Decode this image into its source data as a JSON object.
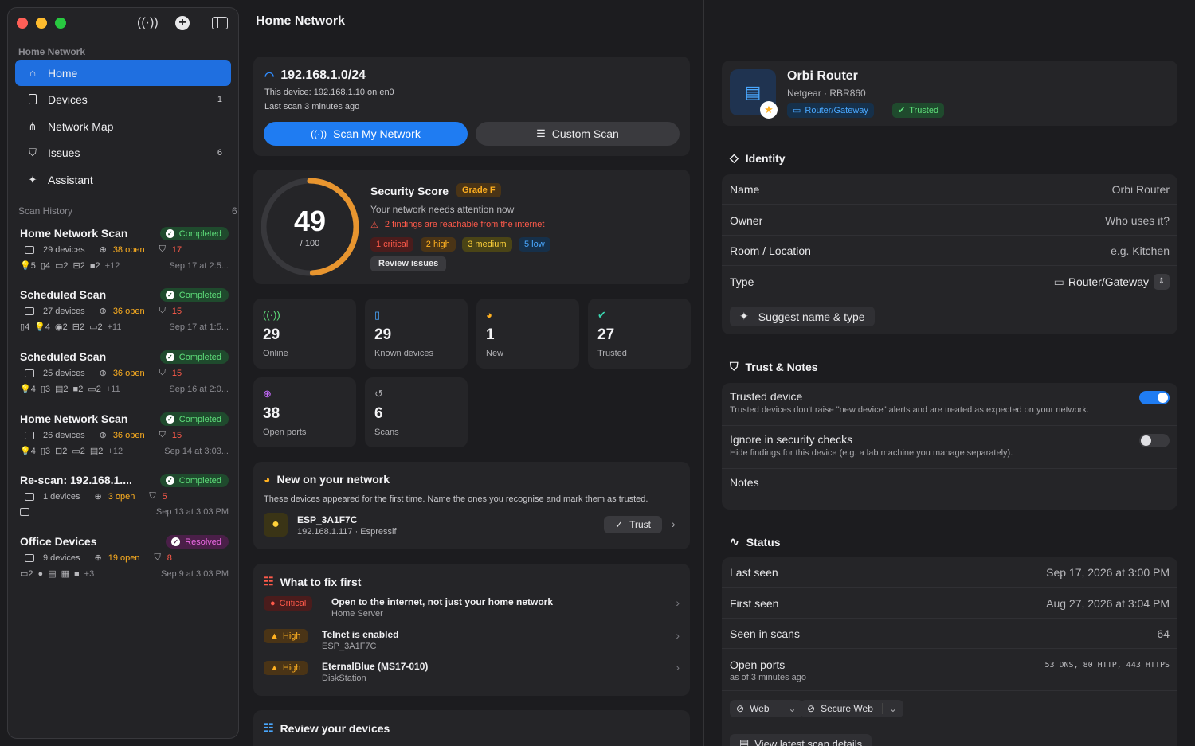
{
  "sidebar": {
    "section_title": "Home Network",
    "nav": [
      {
        "label": "Home",
        "count": ""
      },
      {
        "label": "Devices",
        "count": "1"
      },
      {
        "label": "Network Map",
        "count": ""
      },
      {
        "label": "Issues",
        "count": "6"
      },
      {
        "label": "Assistant",
        "count": ""
      }
    ],
    "history_title": "Scan History",
    "history_count": "6",
    "scans": [
      {
        "title": "Home Network Scan",
        "status": "Completed",
        "devices": "29 devices",
        "open": "38 open",
        "issues": "17",
        "icons": [
          "5",
          "4",
          "2",
          "2",
          "2",
          "+12"
        ],
        "date": "Sep 17 at 2:5..."
      },
      {
        "title": "Scheduled Scan",
        "status": "Completed",
        "devices": "27 devices",
        "open": "36 open",
        "issues": "15",
        "icons": [
          "4",
          "4",
          "2",
          "2",
          "2",
          "+11"
        ],
        "date": "Sep 17 at 1:5..."
      },
      {
        "title": "Scheduled Scan",
        "status": "Completed",
        "devices": "25 devices",
        "open": "36 open",
        "issues": "15",
        "icons": [
          "4",
          "3",
          "2",
          "2",
          "2",
          "+11"
        ],
        "date": "Sep 16 at 2:0..."
      },
      {
        "title": "Home Network Scan",
        "status": "Completed",
        "devices": "26 devices",
        "open": "36 open",
        "issues": "15",
        "icons": [
          "4",
          "3",
          "2",
          "2",
          "2",
          "+12"
        ],
        "date": "Sep 14 at 3:03..."
      },
      {
        "title": "Re-scan: 192.168.1....",
        "status": "Completed",
        "devices": "1 devices",
        "open": "3 open",
        "issues": "5",
        "icons": [],
        "date": "Sep 13 at 3:03 PM"
      },
      {
        "title": "Office Devices",
        "status": "Resolved",
        "devices": "9 devices",
        "open": "19 open",
        "issues": "8",
        "icons": [
          "2",
          "",
          "",
          "",
          "",
          "+3"
        ],
        "date": "Sep 9 at 3:03 PM"
      }
    ]
  },
  "main": {
    "title": "Home Network",
    "network": {
      "cidr": "192.168.1.0/24",
      "this_device": "This device: 192.168.1.10 on en0",
      "last_scan": "Last scan 3 minutes ago",
      "scan_btn": "Scan My Network",
      "custom_btn": "Custom Scan"
    },
    "score": {
      "value": "49",
      "of": "/ 100",
      "fraction": 0.49,
      "title": "Security Score",
      "grade": "Grade F",
      "subtitle": "Your network needs attention now",
      "reachable": "2 findings are reachable from the internet",
      "critical": "1 critical",
      "high": "2 high",
      "medium": "3 medium",
      "low": "5 low",
      "review": "Review issues"
    },
    "stats": [
      {
        "num": "29",
        "label": "Online"
      },
      {
        "num": "29",
        "label": "Known devices"
      },
      {
        "num": "1",
        "label": "New"
      },
      {
        "num": "27",
        "label": "Trusted"
      },
      {
        "num": "38",
        "label": "Open ports"
      },
      {
        "num": "6",
        "label": "Scans"
      }
    ],
    "new_devices": {
      "title": "New on your network",
      "desc": "These devices appeared for the first time. Name the ones you recognise and mark them as trusted.",
      "device_name": "ESP_3A1F7C",
      "device_info": "192.168.1.117 · Espressif",
      "trust_btn": "Trust"
    },
    "fix": {
      "title": "What to fix first",
      "items": [
        {
          "sev": "Critical",
          "title": "Open to the internet, not just your home network",
          "sub": "Home Server"
        },
        {
          "sev": "High",
          "title": "Telnet is enabled",
          "sub": "ESP_3A1F7C"
        },
        {
          "sev": "High",
          "title": "EternalBlue (MS17-010)",
          "sub": "DiskStation"
        }
      ]
    },
    "review": {
      "title": "Review your devices"
    }
  },
  "detail": {
    "name": "Orbi Router",
    "vendor": "Netgear · RBR860",
    "type_tag": "Router/Gateway",
    "trusted_tag": "Trusted",
    "identity_title": "Identity",
    "identity": [
      {
        "k": "Name",
        "v": "Orbi Router"
      },
      {
        "k": "Owner",
        "v": "Who uses it?"
      },
      {
        "k": "Room / Location",
        "v": "e.g. Kitchen"
      },
      {
        "k": "Type",
        "v": "Router/Gateway"
      }
    ],
    "suggest_btn": "Suggest name & type",
    "trust_title": "Trust & Notes",
    "trusted_label": "Trusted device",
    "trusted_desc": "Trusted devices don't raise \"new device\" alerts and are treated as expected on your network.",
    "ignore_label": "Ignore in security checks",
    "ignore_desc": "Hide findings for this device (e.g. a lab machine you manage separately).",
    "notes_label": "Notes",
    "status_title": "Status",
    "status": [
      {
        "k": "Last seen",
        "v": "Sep 17, 2026 at 3:00 PM"
      },
      {
        "k": "First seen",
        "v": "Aug 27, 2026 at 3:04 PM"
      },
      {
        "k": "Seen in scans",
        "v": "64"
      }
    ],
    "open_ports_label": "Open ports",
    "open_ports_sub": "as of 3 minutes ago",
    "open_ports_value": "53 DNS, 80 HTTP, 443 HTTPS",
    "web_btn": "Web",
    "secure_web_btn": "Secure Web",
    "view_scan_btn": "View latest scan details"
  },
  "colors": {
    "accent": "#1f7cf2",
    "critical": "#ff5a4a",
    "high": "#ffb020",
    "ok": "#5fe07b"
  }
}
